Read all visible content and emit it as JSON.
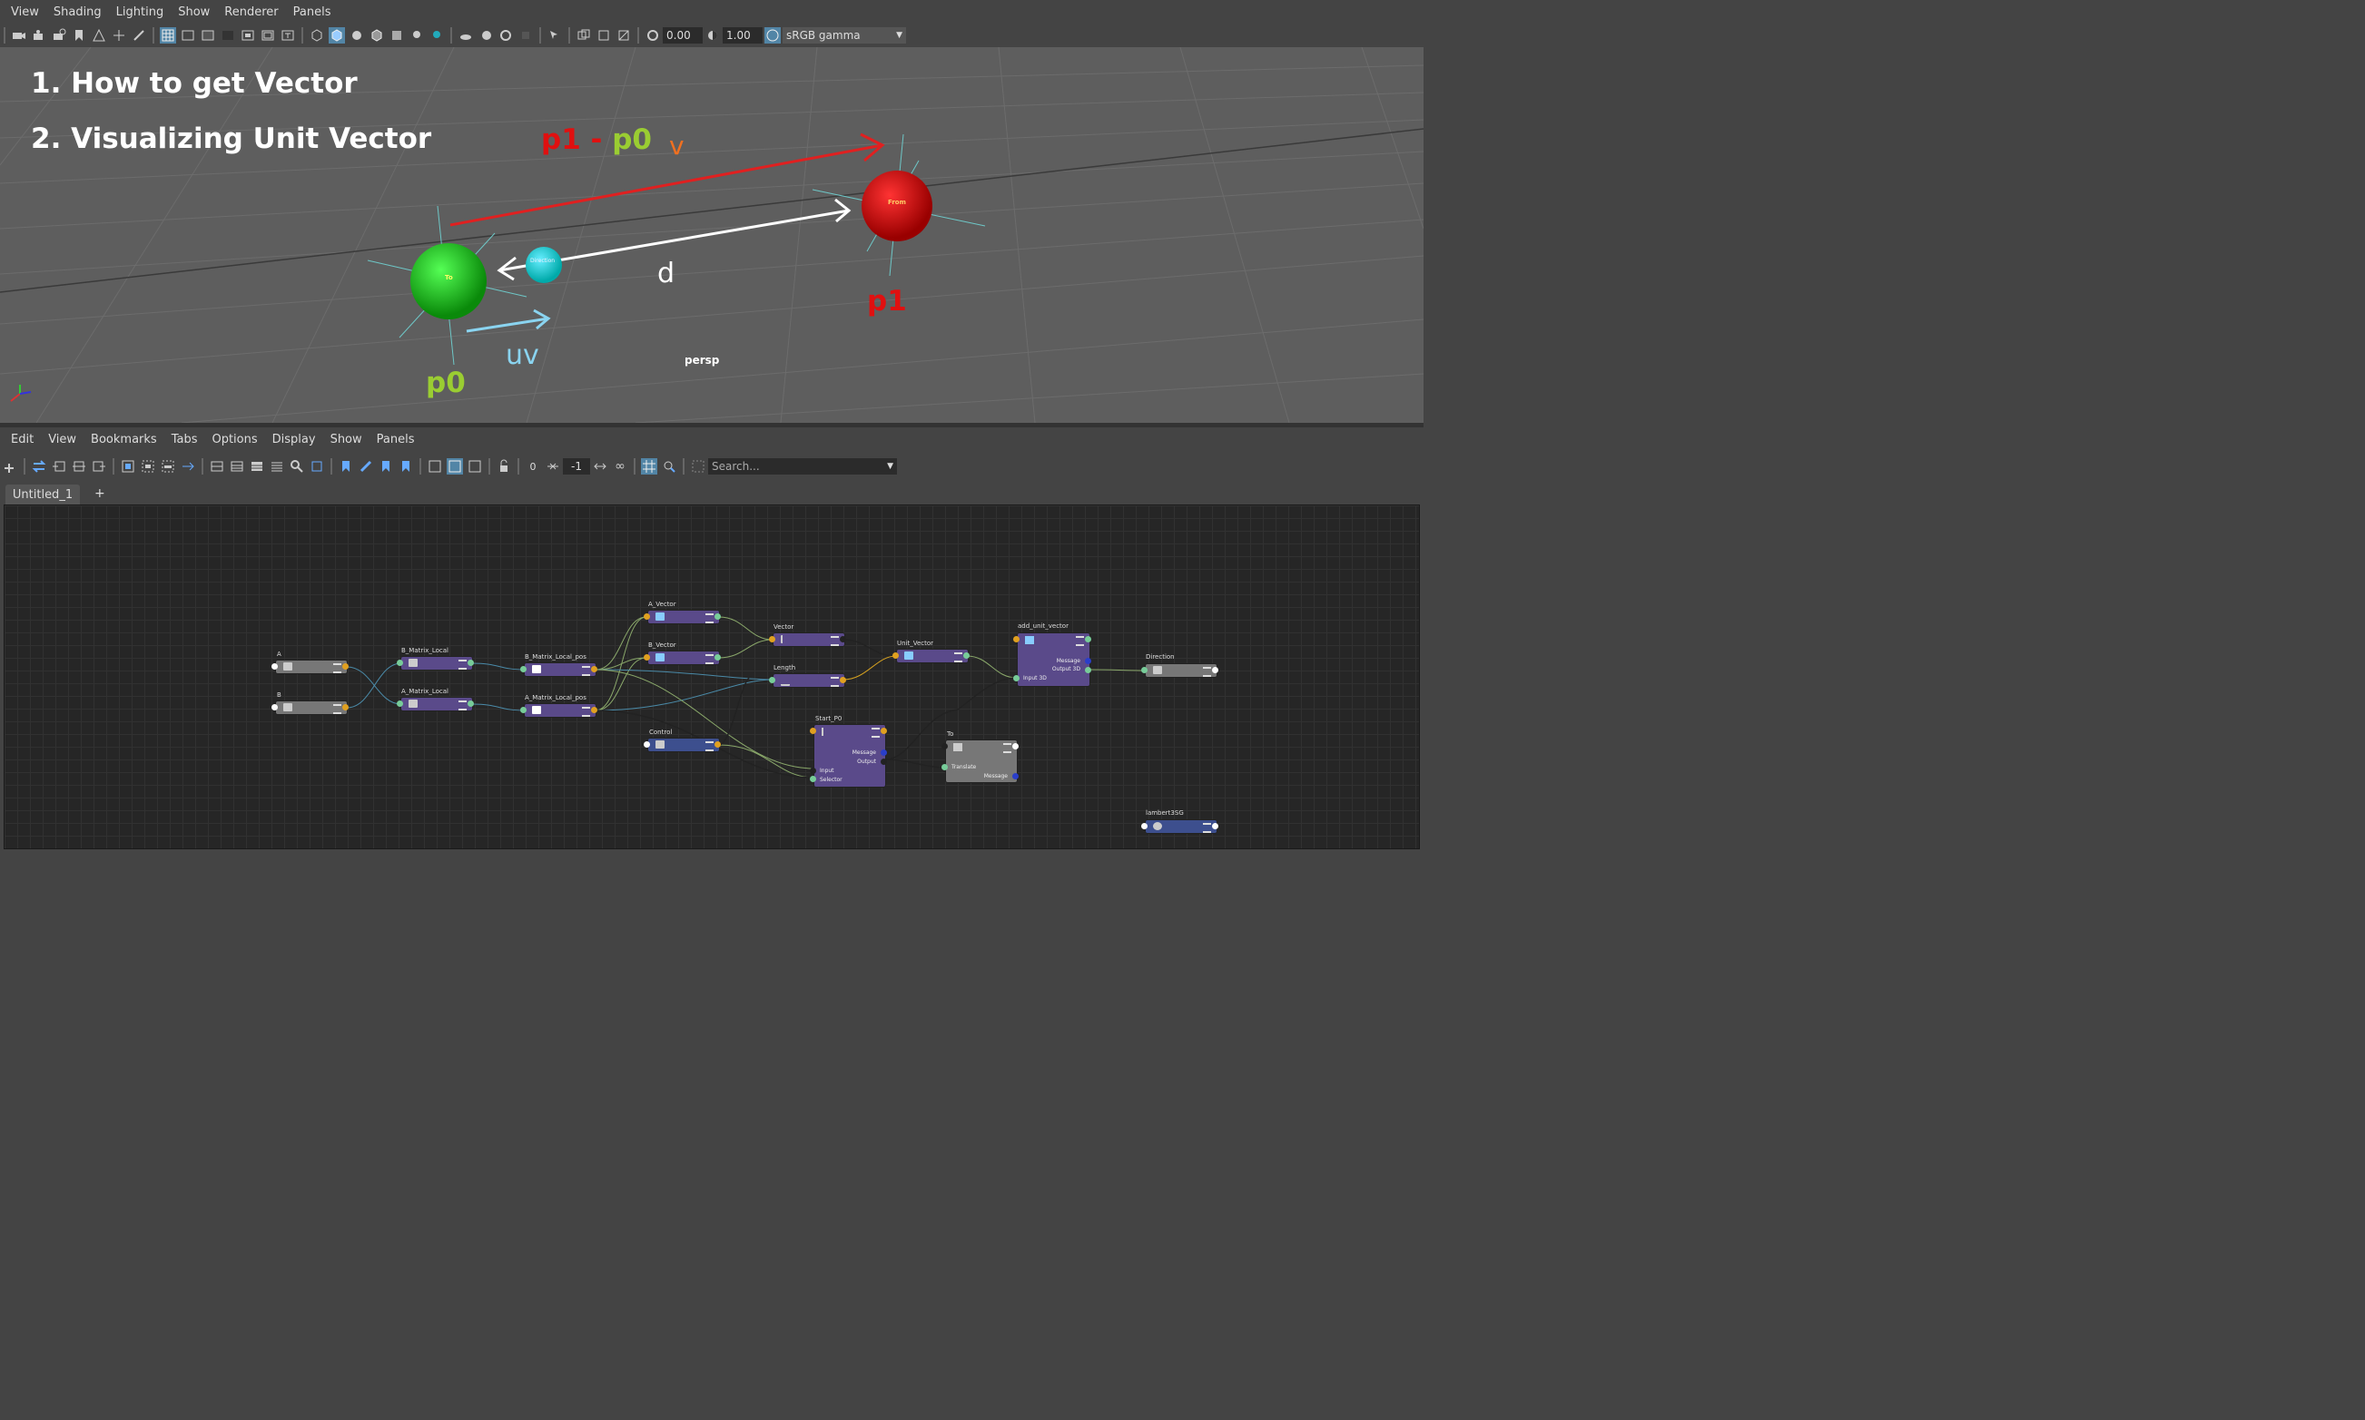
{
  "top_menu": [
    "View",
    "Shading",
    "Lighting",
    "Show",
    "Renderer",
    "Panels"
  ],
  "top_toolbar": {
    "exposure": "0.00",
    "gamma": "1.00",
    "color_space": "sRGB gamma"
  },
  "viewport": {
    "title1": "1. How to get Vector",
    "title2": "2. Visualizing Unit Vector",
    "label_p1_minus_p0_a": "p1",
    "label_p1_minus_p0_b": " - ",
    "label_p1_minus_p0_c": "p0",
    "label_v": "v",
    "label_d": "d",
    "label_p1": "p1",
    "label_p0": "p0",
    "label_uv": "uv",
    "sphere_from": "From",
    "sphere_to": "To",
    "sphere_direction": "Direction",
    "camera": "persp",
    "colors": {
      "red": "#e01010",
      "green": "#22cc22",
      "cyan": "#22c8d8",
      "orange": "#f07020",
      "lime": "#9acd32",
      "lightblue": "#8ad4f0"
    }
  },
  "ne_menu": [
    "Edit",
    "View",
    "Bookmarks",
    "Tabs",
    "Options",
    "Display",
    "Show",
    "Panels"
  ],
  "ne_toolbar": {
    "num_zero": "0",
    "num_neg": "-1",
    "search_placeholder": "Search..."
  },
  "tabs": {
    "active": "Untitled_1",
    "add": "+"
  },
  "nodes": {
    "a": "A",
    "b": "B",
    "b_matrix_local": "B_Matrix_Local",
    "a_matrix_local": "A_Matrix_Local",
    "b_matrix_local_pos": "B_Matrix_Local_pos",
    "a_matrix_local_pos": "A_Matrix_Local_pos",
    "a_vector": "A_Vector",
    "b_vector": "B_Vector",
    "vector": "Vector",
    "length": "Length",
    "unit_vector": "Unit_Vector",
    "add_unit_vector": "add_unit_vector",
    "direction": "Direction",
    "control": "Control",
    "start_p0": "Start_P0",
    "to": "To",
    "lambert3sg": "lambert3SG",
    "start_rows": {
      "message": "Message",
      "output": "Output",
      "input": "Input",
      "selector": "Selector"
    },
    "add_rows": {
      "message": "Message",
      "output3d": "Output 3D",
      "input3d": "Input 3D"
    },
    "to_rows": {
      "translate": "Translate",
      "message": "Message"
    }
  }
}
